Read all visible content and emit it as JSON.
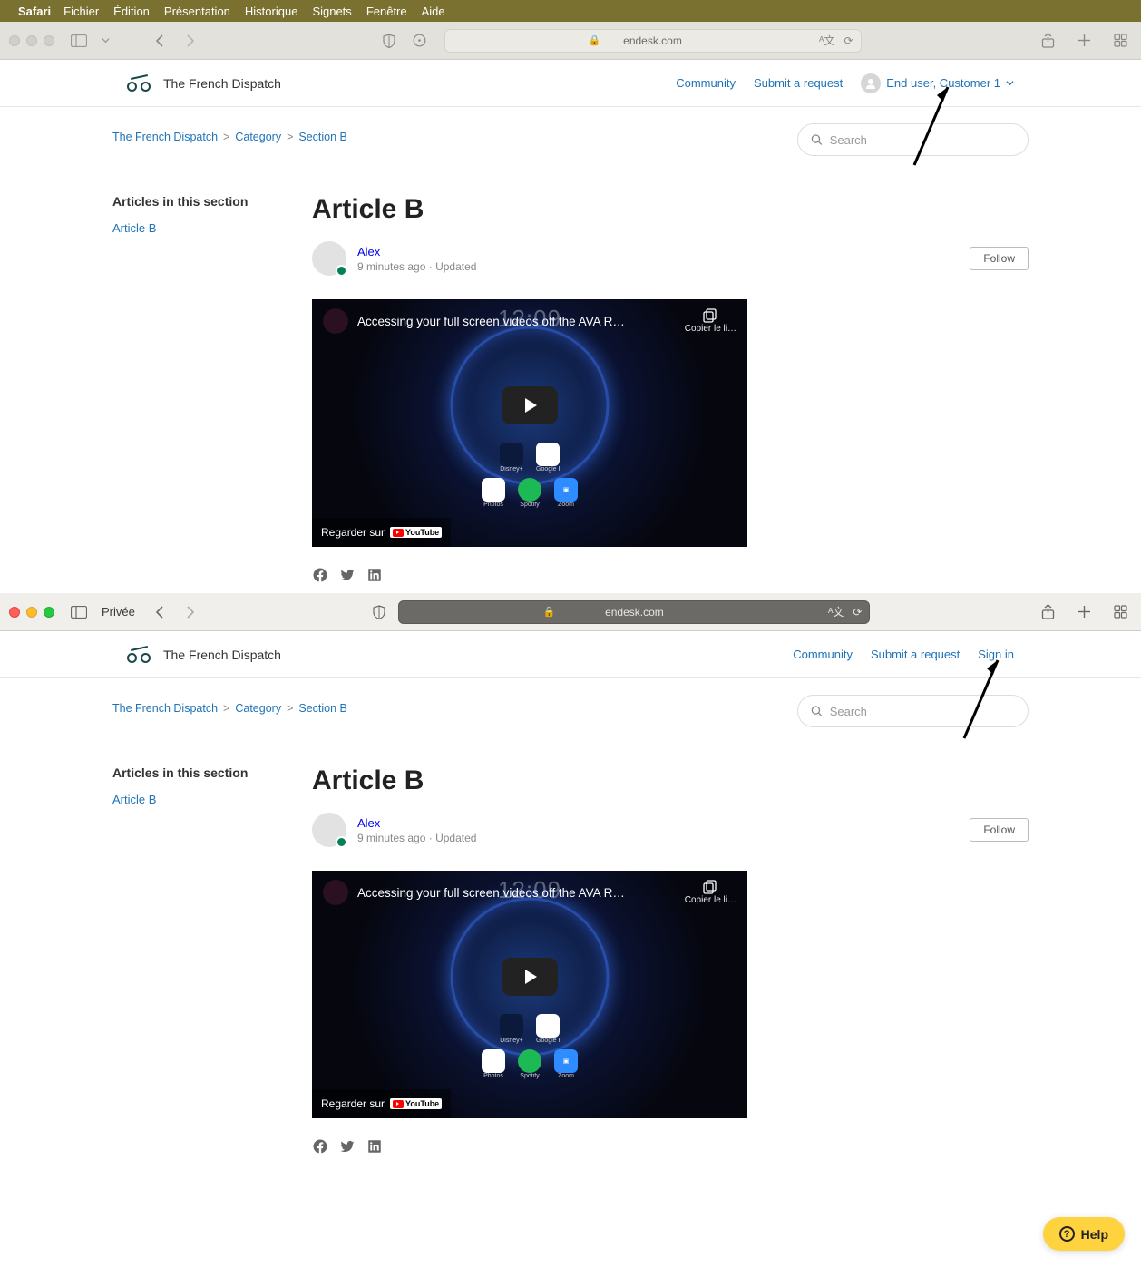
{
  "menubar": {
    "app": "Safari",
    "items": [
      "Fichier",
      "Édition",
      "Présentation",
      "Historique",
      "Signets",
      "Fenêtre",
      "Aide"
    ]
  },
  "window1": {
    "url": "endesk.com",
    "brand": "The French Dispatch",
    "nav": {
      "community": "Community",
      "submit": "Submit a request",
      "user": "End user, Customer 1"
    },
    "breadcrumbs": {
      "a": "The French Dispatch",
      "b": "Category",
      "c": "Section B"
    },
    "search_placeholder": "Search",
    "sidebar": {
      "heading": "Articles in this section",
      "item1": "Article B"
    },
    "article": {
      "title": "Article B",
      "author": "Alex",
      "time": "9 minutes ago",
      "updated": "Updated",
      "follow": "Follow"
    },
    "video": {
      "title": "Accessing your full screen videos off the AVA R…",
      "clock": "12:09",
      "copy": "Copier le li…",
      "watch": "Regarder sur",
      "youtube": "YouTube"
    }
  },
  "window2": {
    "private_label": "Privée",
    "url": "endesk.com",
    "brand": "The French Dispatch",
    "nav": {
      "community": "Community",
      "submit": "Submit a request",
      "signin": "Sign in"
    },
    "breadcrumbs": {
      "a": "The French Dispatch",
      "b": "Category",
      "c": "Section B"
    },
    "search_placeholder": "Search",
    "sidebar": {
      "heading": "Articles in this section",
      "item1": "Article B"
    },
    "article": {
      "title": "Article B",
      "author": "Alex",
      "time": "9 minutes ago",
      "updated": "Updated",
      "follow": "Follow"
    },
    "video": {
      "title": "Accessing your full screen videos off the AVA R…",
      "clock": "12:09",
      "copy": "Copier le li…",
      "watch": "Regarder sur",
      "youtube": "YouTube"
    }
  },
  "help": {
    "label": "Help"
  }
}
